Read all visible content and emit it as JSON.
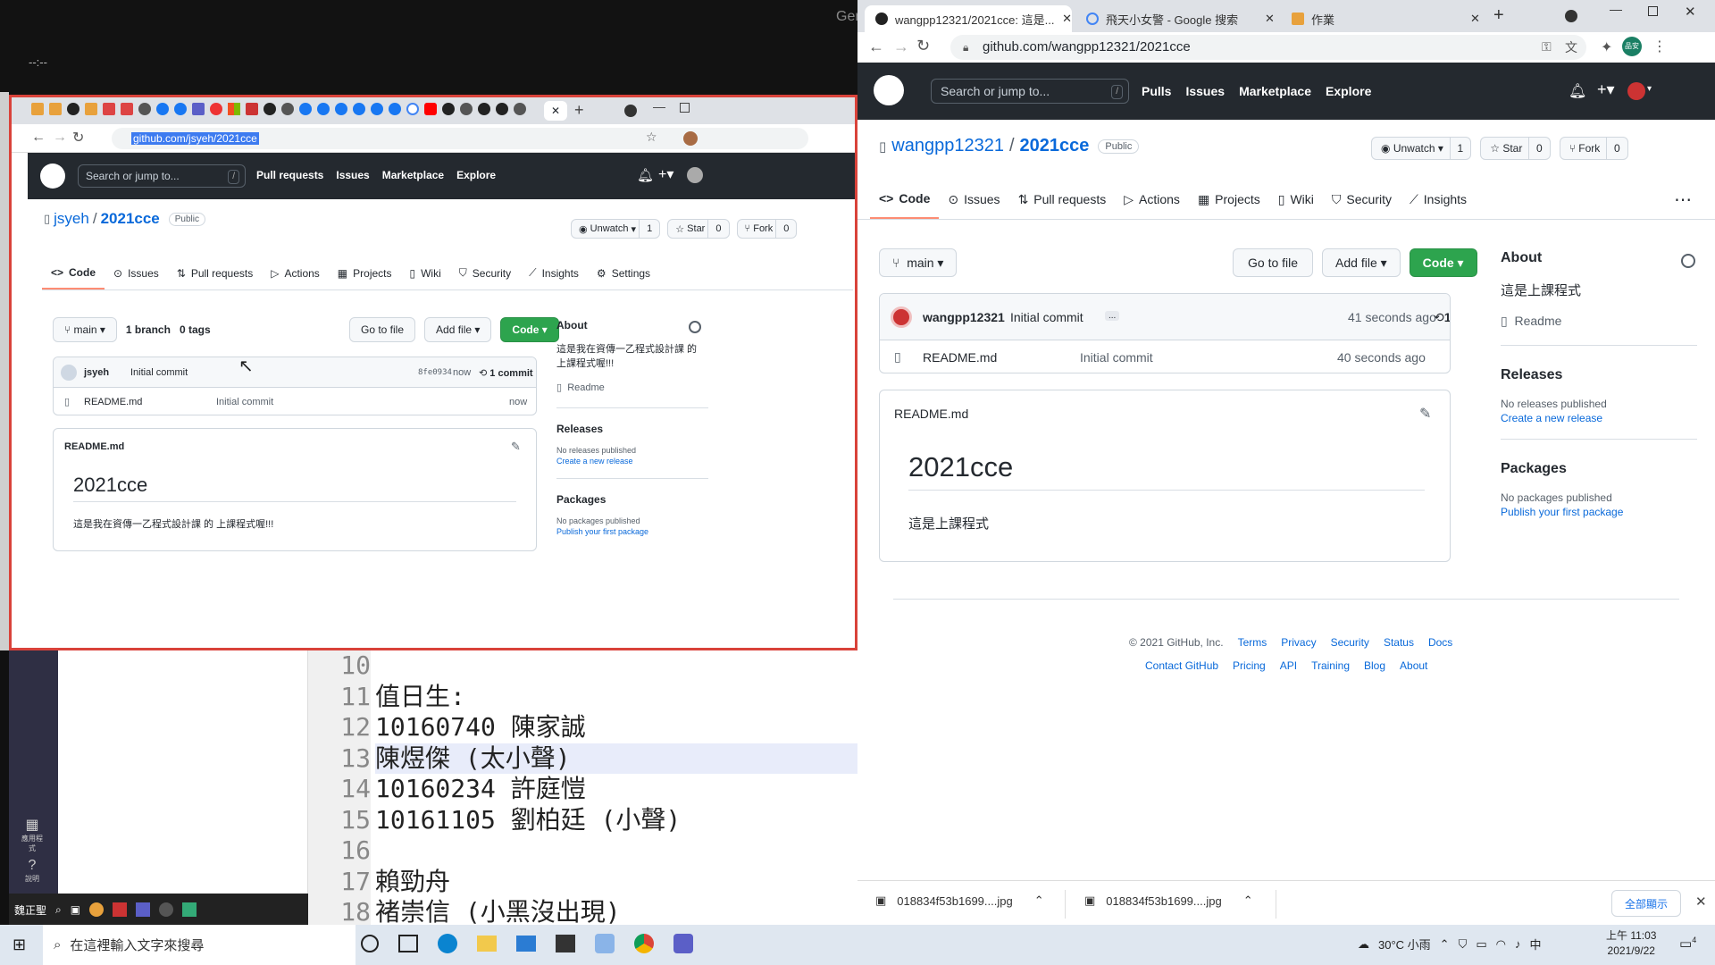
{
  "backdrop": {
    "gen_text": "Gen",
    "tiny_text": "--:--"
  },
  "left_browser": {
    "url": "github.com/jsyeh/2021cce",
    "search_placeholder": "Search or jump to...",
    "slash": "/",
    "nav": [
      "Pull requests",
      "Issues",
      "Marketplace",
      "Explore"
    ],
    "owner": "jsyeh",
    "sep": "/",
    "repo": "2021cce",
    "visibility": "Public",
    "unwatch": "Unwatch",
    "unwatch_count": "1",
    "star": "Star",
    "star_count": "0",
    "fork": "Fork",
    "fork_count": "0",
    "tabs": [
      "Code",
      "Issues",
      "Pull requests",
      "Actions",
      "Projects",
      "Wiki",
      "Security",
      "Insights",
      "Settings"
    ],
    "branch": "main",
    "branches": "1 branch",
    "tags": "0 tags",
    "goto": "Go to file",
    "addfile": "Add file",
    "code": "Code",
    "commit_user": "jsyeh",
    "commit_msg": "Initial commit",
    "commit_hash": "8fe0934",
    "commit_time": "now",
    "commits": "1 commit",
    "file_name": "README.md",
    "file_msg": "Initial commit",
    "file_time": "now",
    "readme_title": "README.md",
    "readme_h1": "2021cce",
    "readme_text": "這是我在資傳一乙程式設計課 的 上課程式喔!!!",
    "about": "About",
    "about_text": "這是我在資傳一乙程式設計課 的 上課程式喔!!!",
    "readme_link": "Readme",
    "releases": "Releases",
    "no_releases": "No releases published",
    "create_release": "Create a new release",
    "packages": "Packages",
    "no_packages": "No packages published",
    "publish_pkg": "Publish your first package"
  },
  "notepad": {
    "line_numbers": [
      "10",
      "11",
      "12",
      "13",
      "14",
      "15",
      "16",
      "17",
      "18"
    ],
    "lines": [
      "",
      "值日生:",
      "10160740 陳家誠",
      "陳煜傑 (太小聲)",
      "10160234 許庭愷",
      "10161105 劉柏廷 (小聲)",
      "",
      "賴勁舟",
      "褚崇信 (小黑沒出現)"
    ],
    "side_labels": [
      "應用程式",
      "說明"
    ],
    "task_label": "魏正聖"
  },
  "right_browser": {
    "tabs": [
      "wangpp12321/2021cce: 這是...",
      "飛天小女警 - Google 搜索",
      "作業"
    ],
    "url": "github.com/wangpp12321/2021cce",
    "avatar_text": "品安",
    "search_placeholder": "Search or jump to...",
    "slash": "/",
    "nav": [
      "Pulls",
      "Issues",
      "Marketplace",
      "Explore"
    ],
    "owner": "wangpp12321",
    "sep": "/",
    "repo": "2021cce",
    "visibility": "Public",
    "unwatch": "Unwatch",
    "unwatch_count": "1",
    "star": "Star",
    "star_count": "0",
    "fork": "Fork",
    "fork_count": "0",
    "tabs2": [
      "Code",
      "Issues",
      "Pull requests",
      "Actions",
      "Projects",
      "Wiki",
      "Security",
      "Insights"
    ],
    "branch": "main",
    "goto": "Go to file",
    "addfile": "Add file",
    "code": "Code",
    "commit_user": "wangpp12321",
    "commit_msg": "Initial commit",
    "commit_more": "...",
    "commit_time": "41 seconds ago",
    "commit_count": "1",
    "file_name": "README.md",
    "file_msg": "Initial commit",
    "file_time": "40 seconds ago",
    "readme_title": "README.md",
    "readme_h1": "2021cce",
    "readme_text": "這是上課程式",
    "about": "About",
    "about_text": "這是上課程式",
    "readme_link": "Readme",
    "releases": "Releases",
    "no_releases": "No releases published",
    "create_release": "Create a new release",
    "packages": "Packages",
    "no_packages": "No packages published",
    "publish_pkg": "Publish your first package",
    "footer_copy": "© 2021 GitHub, Inc.",
    "footer1": [
      "Terms",
      "Privacy",
      "Security",
      "Status",
      "Docs"
    ],
    "footer2": [
      "Contact GitHub",
      "Pricing",
      "API",
      "Training",
      "Blog",
      "About"
    ],
    "downloads": [
      "018834f53b1699....jpg",
      "018834f53b1699....jpg"
    ],
    "show_all": "全部顯示"
  },
  "taskbar": {
    "search_placeholder": "在這裡輸入文字來搜尋",
    "weather": "30°C 小雨",
    "ime": "中",
    "time": "上午 11:03",
    "date": "2021/9/22",
    "notif": "4"
  },
  "colors": {
    "gh_dark": "#24292f",
    "green": "#2da44e",
    "link": "#0969da",
    "accent_red": "#d9423a"
  }
}
